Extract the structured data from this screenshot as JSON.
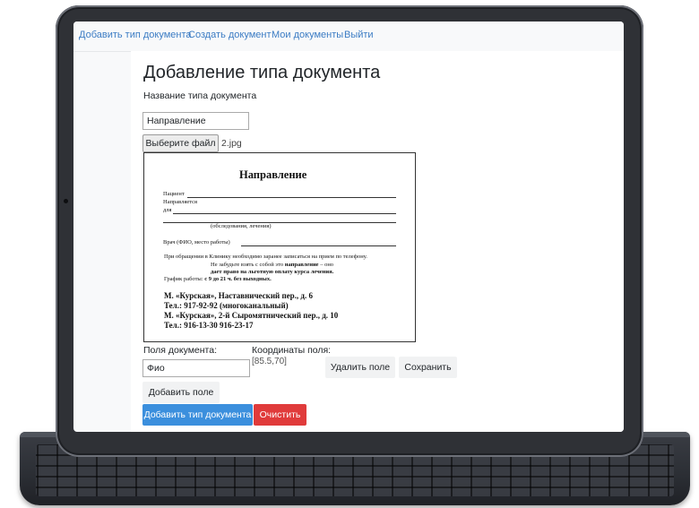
{
  "nav": {
    "add_doc_type": "Добавить тип документа",
    "create_doc": "Создать документ",
    "my_docs": "Мои документы",
    "logout": "Выйти"
  },
  "page": {
    "title": "Добавление типа документа",
    "doctype_name_label": "Название типа документа",
    "doctype_name_value": "Направление",
    "file_button": "Выберите файл",
    "file_name": "2.jpg"
  },
  "document_preview": {
    "heading": "Направление",
    "patient": "Пациент",
    "directed": "Направляется",
    "for": "для",
    "exam_note": "(обследования, лечения)",
    "doctor": "Врач (ФИО, место работы)",
    "note1": "При обращении в Клинику необходимо заранее записаться на прием по телефону.",
    "note2a": "Не забудьте взять с собой это ",
    "note2b": "направление",
    "note2c": " – оно",
    "note3": "дает право на льготную оплату курса лечения.",
    "schedule_a": "График работы: ",
    "schedule_b": "с 9 до 21 ч. без выходных.",
    "addr1": "М. «Курская», Наставнический пер., д. 6",
    "tel1": "Тел.: 917-92-92 (многоканальный)",
    "addr2": "М. «Курская», 2-й Сыромятнический пер.,  д. 10",
    "tel2": "Тел.: 916-13-30    916-23-17"
  },
  "fields": {
    "fields_label": "Поля документа:",
    "coords_label": "Координаты поля:",
    "field_value": "Фио",
    "coords_value": "[85.5,70]",
    "delete_field": "Удалить поле",
    "save": "Сохранить",
    "add_field": "Добавить поле"
  },
  "actions": {
    "add_doc_type": "Добавить тип документа",
    "clear": "Очистить"
  },
  "colors": {
    "primary": "#3b8fdd",
    "danger": "#e03b3b",
    "link": "#3b7cc4"
  }
}
